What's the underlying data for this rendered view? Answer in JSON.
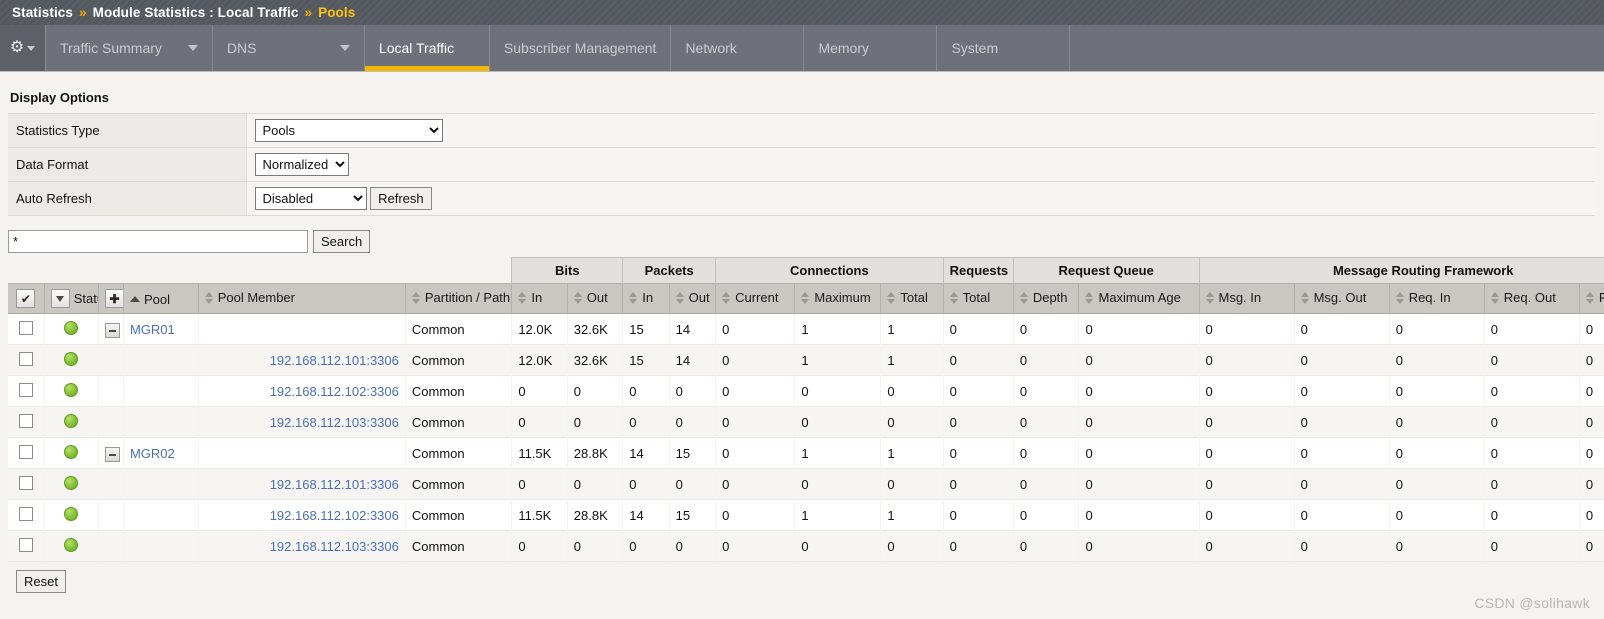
{
  "breadcrumb": {
    "items": [
      "Statistics",
      "Module Statistics : Local Traffic",
      "Pools"
    ],
    "separator": "»"
  },
  "nav": {
    "gear_icon": "gear-icon",
    "tabs": [
      {
        "label": "Traffic Summary",
        "active": false,
        "dropdown": true
      },
      {
        "label": "DNS",
        "active": false,
        "dropdown": true
      },
      {
        "label": "Local Traffic",
        "active": true,
        "dropdown": false
      },
      {
        "label": "Subscriber Management",
        "active": false,
        "dropdown": false
      },
      {
        "label": "Network",
        "active": false,
        "dropdown": false
      },
      {
        "label": "Memory",
        "active": false,
        "dropdown": false
      },
      {
        "label": "System",
        "active": false,
        "dropdown": false
      }
    ]
  },
  "display_options": {
    "title": "Display Options",
    "rows": [
      {
        "label": "Statistics Type",
        "value": "Pools"
      },
      {
        "label": "Data Format",
        "value": "Normalized"
      },
      {
        "label": "Auto Refresh",
        "value": "Disabled"
      }
    ],
    "refresh_button": "Refresh"
  },
  "search": {
    "value": "*",
    "placeholder": "",
    "button": "Search"
  },
  "table": {
    "group_headers": [
      {
        "label": "",
        "span": 4,
        "blank": true
      },
      {
        "label": "Bits",
        "span": 2,
        "blank": false
      },
      {
        "label": "Packets",
        "span": 2,
        "blank": false
      },
      {
        "label": "Connections",
        "span": 3,
        "blank": false
      },
      {
        "label": "Requests",
        "span": 1,
        "blank": false
      },
      {
        "label": "Request Queue",
        "span": 2,
        "blank": false
      },
      {
        "label": "Message Routing Framework",
        "span": 5,
        "blank": false
      }
    ],
    "columns": [
      {
        "label": "Status",
        "sort": "down-box"
      },
      {
        "label": "Pool",
        "sort": "up"
      },
      {
        "label": "Pool Member",
        "sort": "both"
      },
      {
        "label": "Partition / Path",
        "sort": "both"
      },
      {
        "label": "In",
        "sort": "both"
      },
      {
        "label": "Out",
        "sort": "both"
      },
      {
        "label": "In",
        "sort": "both"
      },
      {
        "label": "Out",
        "sort": "both"
      },
      {
        "label": "Current",
        "sort": "both"
      },
      {
        "label": "Maximum",
        "sort": "both"
      },
      {
        "label": "Total",
        "sort": "both"
      },
      {
        "label": "Total",
        "sort": "both"
      },
      {
        "label": "Depth",
        "sort": "both"
      },
      {
        "label": "Maximum Age",
        "sort": "both"
      },
      {
        "label": "Msg. In",
        "sort": "both"
      },
      {
        "label": "Msg. Out",
        "sort": "both"
      },
      {
        "label": "Req. In",
        "sort": "both"
      },
      {
        "label": "Req. Out",
        "sort": "both"
      },
      {
        "label": "R",
        "sort": "both"
      }
    ],
    "rows": [
      {
        "status": "green",
        "is_parent": true,
        "pool": "MGR01",
        "member": "",
        "partition": "Common",
        "values": [
          "12.0K",
          "32.6K",
          "15",
          "14",
          "0",
          "1",
          "1",
          "0",
          "0",
          "0",
          "0",
          "0",
          "0",
          "0",
          "0"
        ]
      },
      {
        "status": "green",
        "is_parent": false,
        "pool": "",
        "member": "192.168.112.101:3306",
        "partition": "Common",
        "values": [
          "12.0K",
          "32.6K",
          "15",
          "14",
          "0",
          "1",
          "1",
          "0",
          "0",
          "0",
          "0",
          "0",
          "0",
          "0",
          "0"
        ]
      },
      {
        "status": "green",
        "is_parent": false,
        "pool": "",
        "member": "192.168.112.102:3306",
        "partition": "Common",
        "values": [
          "0",
          "0",
          "0",
          "0",
          "0",
          "0",
          "0",
          "0",
          "0",
          "0",
          "0",
          "0",
          "0",
          "0",
          "0"
        ]
      },
      {
        "status": "green",
        "is_parent": false,
        "pool": "",
        "member": "192.168.112.103:3306",
        "partition": "Common",
        "values": [
          "0",
          "0",
          "0",
          "0",
          "0",
          "0",
          "0",
          "0",
          "0",
          "0",
          "0",
          "0",
          "0",
          "0",
          "0"
        ]
      },
      {
        "status": "green",
        "is_parent": true,
        "pool": "MGR02",
        "member": "",
        "partition": "Common",
        "values": [
          "11.5K",
          "28.8K",
          "14",
          "15",
          "0",
          "1",
          "1",
          "0",
          "0",
          "0",
          "0",
          "0",
          "0",
          "0",
          "0"
        ]
      },
      {
        "status": "green",
        "is_parent": false,
        "pool": "",
        "member": "192.168.112.101:3306",
        "partition": "Common",
        "values": [
          "0",
          "0",
          "0",
          "0",
          "0",
          "0",
          "0",
          "0",
          "0",
          "0",
          "0",
          "0",
          "0",
          "0",
          "0"
        ]
      },
      {
        "status": "green",
        "is_parent": false,
        "pool": "",
        "member": "192.168.112.102:3306",
        "partition": "Common",
        "values": [
          "11.5K",
          "28.8K",
          "14",
          "15",
          "0",
          "1",
          "1",
          "0",
          "0",
          "0",
          "0",
          "0",
          "0",
          "0",
          "0"
        ]
      },
      {
        "status": "green",
        "is_parent": false,
        "pool": "",
        "member": "192.168.112.103:3306",
        "partition": "Common",
        "values": [
          "0",
          "0",
          "0",
          "0",
          "0",
          "0",
          "0",
          "0",
          "0",
          "0",
          "0",
          "0",
          "0",
          "0",
          "0"
        ]
      }
    ]
  },
  "footer": {
    "reset_button": "Reset",
    "watermark": "CSDN @solihawk"
  },
  "colors": {
    "breadcrumb_bg": "#54585f",
    "nav_bg": "#6e7179",
    "accent": "#f5b800",
    "link": "#4a6fb5",
    "status_green": "#8ec63f"
  }
}
